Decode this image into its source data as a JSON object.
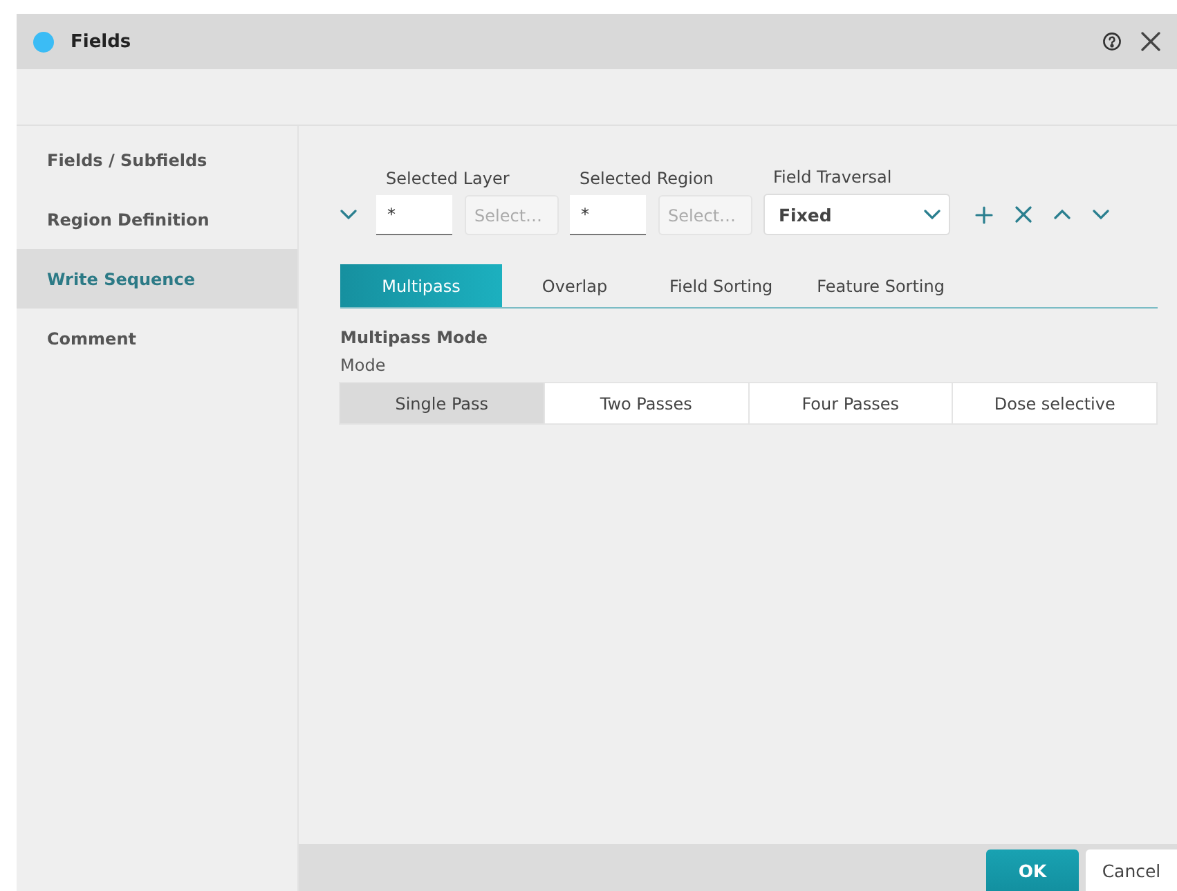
{
  "window": {
    "title": "Fields"
  },
  "sidebar": {
    "items": [
      {
        "label": "Fields / Subfields",
        "selected": false
      },
      {
        "label": "Region Definition",
        "selected": false
      },
      {
        "label": "Write Sequence",
        "selected": true
      },
      {
        "label": "Comment",
        "selected": false
      }
    ]
  },
  "toolbar": {
    "layer": {
      "label": "Selected Layer",
      "value": "*",
      "select_placeholder": "Select…"
    },
    "region": {
      "label": "Selected Region",
      "value": "*",
      "select_placeholder": "Select…"
    },
    "traversal": {
      "label": "Field Traversal",
      "value": "Fixed"
    }
  },
  "tabs": [
    {
      "label": "Multipass",
      "selected": true
    },
    {
      "label": "Overlap",
      "selected": false
    },
    {
      "label": "Field Sorting",
      "selected": false
    },
    {
      "label": "Feature Sorting",
      "selected": false
    }
  ],
  "section_title": "Multipass Mode",
  "mode": {
    "label": "Mode",
    "options": [
      {
        "label": "Single Pass",
        "selected": true
      },
      {
        "label": "Two Passes",
        "selected": false
      },
      {
        "label": "Four Passes",
        "selected": false
      },
      {
        "label": "Dose selective",
        "selected": false
      }
    ]
  },
  "footer": {
    "buttons": [
      {
        "label": "OK",
        "kind": "primary"
      },
      {
        "label": "Cancel",
        "kind": "secondary"
      }
    ]
  }
}
